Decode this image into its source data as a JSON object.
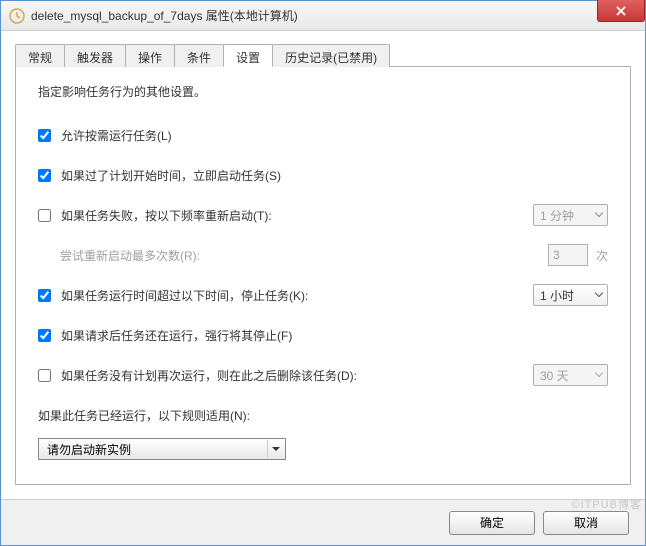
{
  "window": {
    "title": "delete_mysql_backup_of_7days 属性(本地计算机)"
  },
  "tabs": [
    {
      "label": "常规"
    },
    {
      "label": "触发器"
    },
    {
      "label": "操作"
    },
    {
      "label": "条件"
    },
    {
      "label": "设置"
    },
    {
      "label": "历史记录(已禁用)"
    }
  ],
  "activeTab": 4,
  "panel": {
    "intro": "指定影响任务行为的其他设置。",
    "allowDemandRun": {
      "label": "允许按需运行任务(L)",
      "checked": true
    },
    "startWhenMissed": {
      "label": "如果过了计划开始时间，立即启动任务(S)",
      "checked": true
    },
    "restartOnFail": {
      "label": "如果任务失败，按以下频率重新启动(T):",
      "checked": false,
      "interval": "1 分钟"
    },
    "retryMax": {
      "label": "尝试重新启动最多次数(R):",
      "value": "3",
      "unit": "次"
    },
    "stopIfRunsLong": {
      "label": "如果任务运行时间超过以下时间，停止任务(K):",
      "checked": true,
      "duration": "1 小时"
    },
    "forceStop": {
      "label": "如果请求后任务还在运行，强行将其停止(F)",
      "checked": true
    },
    "deleteIfNotScheduled": {
      "label": "如果任务没有计划再次运行，则在此之后删除该任务(D):",
      "checked": false,
      "after": "30 天"
    },
    "ifRunningRule": {
      "label": "如果此任务已经运行，以下规则适用(N):",
      "value": "请勿启动新实例"
    }
  },
  "buttons": {
    "ok": "确定",
    "cancel": "取消"
  },
  "watermark": "©ITPUB博客"
}
